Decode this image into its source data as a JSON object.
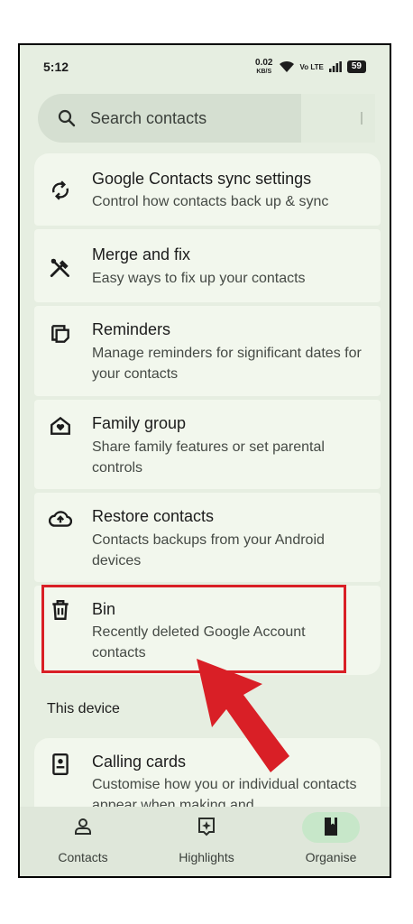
{
  "status_bar": {
    "time": "5:12",
    "data_speed": "0.02",
    "data_unit": "KB/S",
    "network_label": "Vo LTE",
    "battery": "59"
  },
  "search": {
    "placeholder": "Search contacts"
  },
  "cards": [
    {
      "title": "Google Contacts sync settings",
      "subtitle": "Control how contacts back up & sync",
      "icon": "sync-icon"
    },
    {
      "title": "Merge and fix",
      "subtitle": "Easy ways to fix up your contacts",
      "icon": "tools-icon"
    },
    {
      "title": "Reminders",
      "subtitle": "Manage reminders for significant dates for your contacts",
      "icon": "reminder-icon"
    },
    {
      "title": "Family group",
      "subtitle": "Share family features or set parental controls",
      "icon": "family-home-icon"
    },
    {
      "title": "Restore contacts",
      "subtitle": "Contacts backups from your Android devices",
      "icon": "cloud-restore-icon"
    },
    {
      "title": "Bin",
      "subtitle": "Recently deleted Google Account contacts",
      "icon": "trash-icon"
    }
  ],
  "device_section": {
    "title": "This device",
    "card": {
      "title": "Calling cards",
      "subtitle": "Customise how you or individual contacts appear when making and",
      "icon": "calling-card-icon"
    }
  },
  "bottom_nav": [
    {
      "label": "Contacts",
      "icon": "person-icon",
      "selected": false
    },
    {
      "label": "Highlights",
      "icon": "highlights-icon",
      "selected": false
    },
    {
      "label": "Organise",
      "icon": "bookmark-icon",
      "selected": true
    }
  ],
  "colors": {
    "highlight": "#d91f26",
    "background": "#e6eee1",
    "card": "#f2f7ed",
    "selected_pill": "#c7e7c9"
  }
}
